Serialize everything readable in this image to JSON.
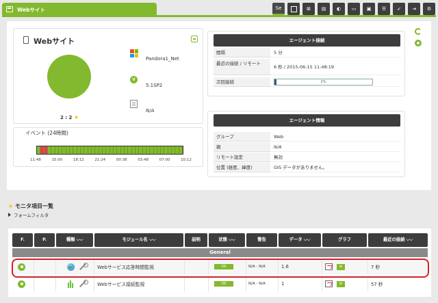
{
  "header": {
    "title": "Webサイト",
    "toolbar": [
      {
        "icon": "setup-icon",
        "label": "Se"
      },
      {
        "icon": "view-icon",
        "label": ""
      },
      {
        "icon": "graph-icon",
        "label": ""
      },
      {
        "icon": "alert-icon",
        "label": ""
      },
      {
        "icon": "gis-icon",
        "label": ""
      },
      {
        "icon": "folder-icon",
        "label": ""
      },
      {
        "icon": "report-icon",
        "label": ""
      },
      {
        "icon": "list-icon",
        "label": ""
      },
      {
        "icon": "rocket-icon",
        "label": ""
      },
      {
        "icon": "login-icon",
        "label": ""
      },
      {
        "icon": "gear-icon",
        "label": ""
      }
    ]
  },
  "agent": {
    "name": "Webサイト",
    "ratio": "2 : 2",
    "os_name": "Pandora1_Net",
    "version": "5.1SP2",
    "ip": "N/A",
    "status_color": "#82b92e"
  },
  "events": {
    "title": "イベント (24時間)",
    "ticks": [
      "11:48",
      "15:00",
      "18:12",
      "21:24",
      "00:36",
      "03:48",
      "07:00",
      "10:12"
    ],
    "bars": [
      "green",
      "red",
      "red",
      "green",
      "green",
      "green",
      "green",
      "green",
      "green",
      "green",
      "green",
      "green",
      "green",
      "green",
      "green",
      "green",
      "green",
      "green",
      "green",
      "green",
      "green",
      "green",
      "green",
      "green",
      "green",
      "green",
      "green",
      "green",
      "green",
      "green",
      "green",
      "green",
      "green",
      "green",
      "green",
      "green",
      "green",
      "green",
      "green",
      "green"
    ]
  },
  "contact": {
    "header": "エージェント接続",
    "interval_label": "間隔",
    "interval_value": "5 分",
    "last_contact_label": "最近の接続 / リモート",
    "last_contact_value": "6 秒 / 2015-06-15 11:48:19",
    "next_contact_label": "次回接続",
    "next_contact_value": "2%",
    "next_contact_progress": 0.02
  },
  "info": {
    "header": "エージェント情報",
    "rows": [
      {
        "k": "グループ",
        "v": "Web"
      },
      {
        "k": "親",
        "v": "N/A"
      },
      {
        "k": "リモート設定",
        "v": "無効"
      },
      {
        "k": "位置 (経度、緯度)",
        "v": "GIS データがありません。"
      }
    ]
  },
  "monitors": {
    "title": "モニタ項目一覧",
    "filter_label": "フォームフィルタ",
    "columns": [
      "F.",
      "P.",
      "種類 ⌵⌵",
      "モジュール名 ⌵⌵",
      "説明",
      "状態 ⌵⌵",
      "警告",
      "データ ⌵⌵",
      "グラフ",
      "最近の接続 ⌵⌵"
    ],
    "group": "General",
    "rows": [
      {
        "name": "Webサービス応答時間監視",
        "status": "OK",
        "warn": "N/A - N/A",
        "data": "1.6",
        "graph_badge": "W",
        "last": "7 秒"
      },
      {
        "name": "Webサービス接続監視",
        "status": "OK",
        "warn": "N/A - N/A",
        "data": "1",
        "graph_badge": "W",
        "last": "57 秒"
      }
    ]
  }
}
